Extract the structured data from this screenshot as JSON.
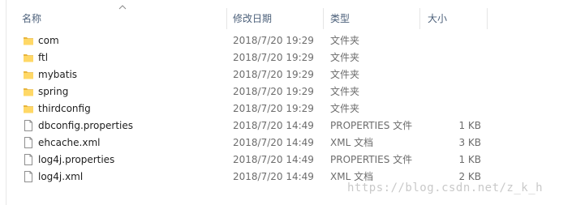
{
  "columns": {
    "name": "名称",
    "date": "修改日期",
    "type": "类型",
    "size": "大小"
  },
  "sort": {
    "column": "name",
    "direction": "ascending"
  },
  "files": [
    {
      "name": "com",
      "date": "2018/7/20 19:29",
      "type": "文件夹",
      "size": "",
      "icon": "folder-icon"
    },
    {
      "name": "ftl",
      "date": "2018/7/20 19:29",
      "type": "文件夹",
      "size": "",
      "icon": "folder-icon"
    },
    {
      "name": "mybatis",
      "date": "2018/7/20 19:29",
      "type": "文件夹",
      "size": "",
      "icon": "folder-icon"
    },
    {
      "name": "spring",
      "date": "2018/7/20 19:29",
      "type": "文件夹",
      "size": "",
      "icon": "folder-icon"
    },
    {
      "name": "thirdconfig",
      "date": "2018/7/20 19:29",
      "type": "文件夹",
      "size": "",
      "icon": "folder-icon"
    },
    {
      "name": "dbconfig.properties",
      "date": "2018/7/20 14:49",
      "type": "PROPERTIES 文件",
      "size": "1 KB",
      "icon": "file-icon"
    },
    {
      "name": "ehcache.xml",
      "date": "2018/7/20 14:49",
      "type": "XML 文档",
      "size": "3 KB",
      "icon": "file-icon"
    },
    {
      "name": "log4j.properties",
      "date": "2018/7/20 14:49",
      "type": "PROPERTIES 文件",
      "size": "1 KB",
      "icon": "file-icon"
    },
    {
      "name": "log4j.xml",
      "date": "2018/7/20 14:49",
      "type": "XML 文档",
      "size": "2 KB",
      "icon": "file-icon"
    }
  ],
  "watermark": "https://blog.csdn.net/z_k_h",
  "colors": {
    "folder": "#ffd866",
    "folder_dark": "#e8b53c",
    "header_text": "#4c607a",
    "secondary_text": "#6d6d6d"
  }
}
